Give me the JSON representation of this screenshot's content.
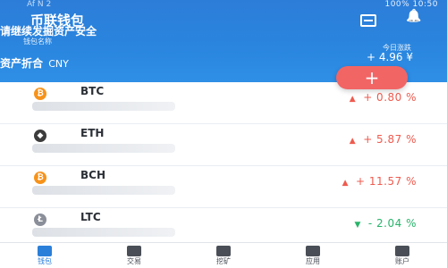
{
  "status_bar": {
    "left": "Af N 2",
    "right": "100% 10:50"
  },
  "header": {
    "title": "币联钱包",
    "notice": "请继续发掘资产安全",
    "account_name": "钱包名称",
    "today_label": "今日涨跌",
    "balance_prefix": "资产折合",
    "balance_unit": "CNY",
    "today_value": "+ 4.96 ¥"
  },
  "add_button": {
    "label": "+"
  },
  "coins": [
    {
      "symbol": "BTC",
      "change": "+ 0.80 %",
      "direction": "up",
      "icon_color": "#f7931a"
    },
    {
      "symbol": "ETH",
      "change": "+ 5.87 %",
      "direction": "up",
      "icon_color": "#3c3c3d"
    },
    {
      "symbol": "BCH",
      "change": "+ 11.57 %",
      "direction": "up",
      "icon_color": "#f7931a"
    },
    {
      "symbol": "LTC",
      "change": "- 2.04 %",
      "direction": "down",
      "icon_color": "#8a8f99"
    }
  ],
  "tabs": [
    {
      "label": "钱包",
      "icon": "wallet-icon",
      "active": true
    },
    {
      "label": "交易",
      "icon": "exchange-icon",
      "active": false
    },
    {
      "label": "挖矿",
      "icon": "mining-icon",
      "active": false
    },
    {
      "label": "应用",
      "icon": "apps-icon",
      "active": false
    },
    {
      "label": "账户",
      "icon": "account-icon",
      "active": false
    }
  ],
  "colors": {
    "header_blue": "#2c7dd8",
    "accent_red": "#f26565",
    "up_red": "#ef5b4f",
    "down_green": "#29b46b"
  }
}
